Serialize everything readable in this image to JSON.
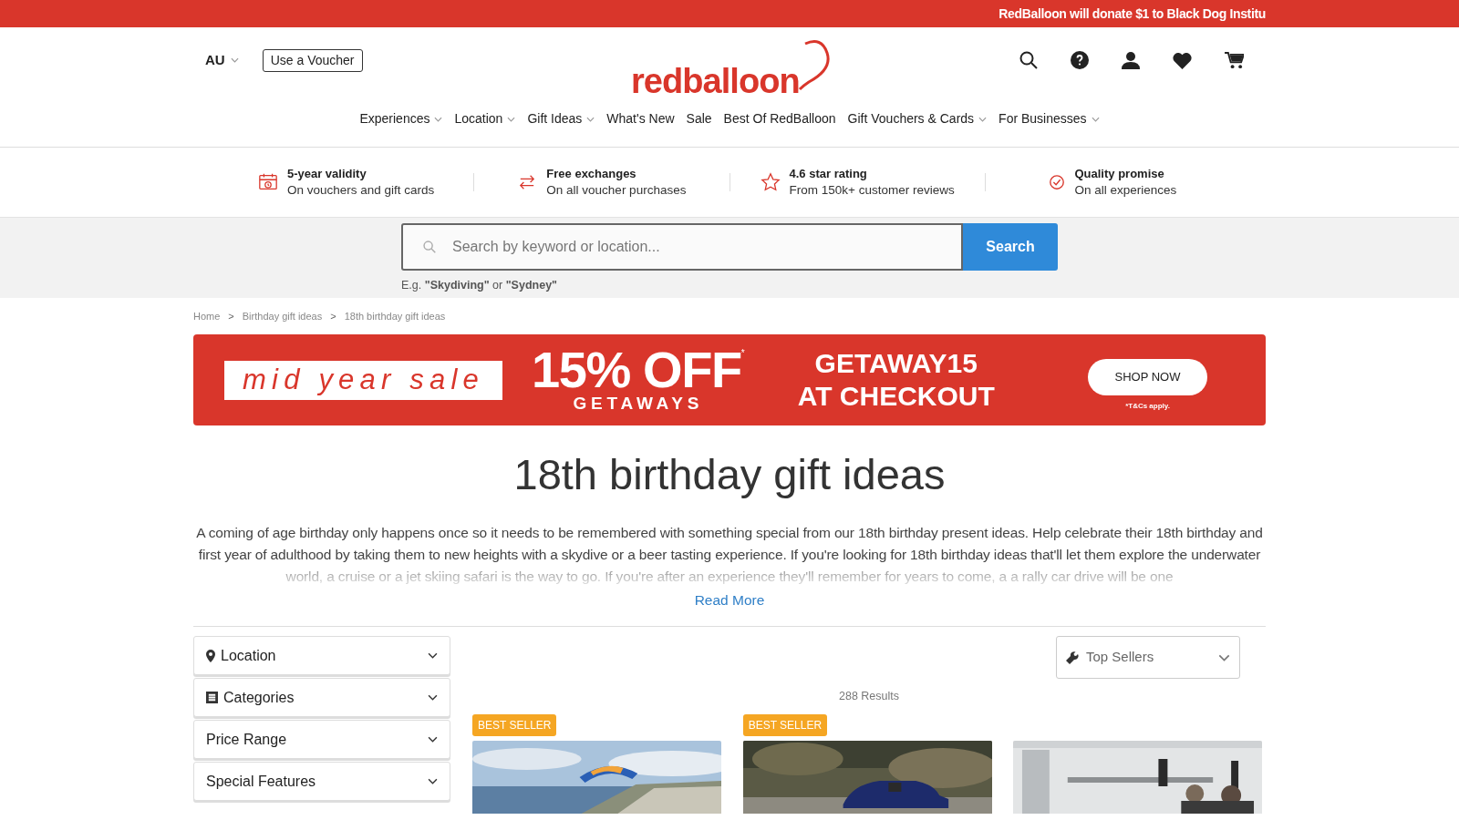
{
  "promo_bar": {
    "text": "RedBalloon will donate $1 to Black Dog Institu"
  },
  "header": {
    "region": "AU",
    "voucher_button": "Use a Voucher",
    "logo": "redballoon"
  },
  "nav": [
    {
      "label": "Experiences",
      "dropdown": true
    },
    {
      "label": "Location",
      "dropdown": true
    },
    {
      "label": "Gift Ideas",
      "dropdown": true
    },
    {
      "label": "What's New",
      "dropdown": false
    },
    {
      "label": "Sale",
      "dropdown": false
    },
    {
      "label": "Best Of RedBalloon",
      "dropdown": false
    },
    {
      "label": "Gift Vouchers & Cards",
      "dropdown": true
    },
    {
      "label": "For Businesses",
      "dropdown": true
    }
  ],
  "features": [
    {
      "kind": "calendar",
      "title": "5-year validity",
      "subtitle": "On vouchers and gift cards"
    },
    {
      "kind": "exchange",
      "title": "Free exchanges",
      "subtitle": "On all voucher purchases"
    },
    {
      "kind": "star",
      "title": "4.6 star rating",
      "subtitle": "From 150k+ customer reviews"
    },
    {
      "kind": "check",
      "title": "Quality promise",
      "subtitle": "On all experiences"
    }
  ],
  "search": {
    "placeholder": "Search by keyword or location...",
    "button": "Search",
    "hint": "E.g. **\"Skydiving\"** or **\"Sydney\"**"
  },
  "breadcrumb": [
    {
      "kind": "link",
      "text": "Home"
    },
    {
      "kind": "separator",
      "text": ">"
    },
    {
      "kind": "link",
      "text": "Birthday gift ideas"
    },
    {
      "kind": "separator",
      "text": ">"
    },
    {
      "kind": "link",
      "text": "18th birthday gift ideas"
    }
  ],
  "banner": {
    "sale": "mid year sale",
    "discount": "15% OFF",
    "mark": "*",
    "category": "GETAWAYS",
    "code": "GETAWAY15",
    "code_note": "AT CHECKOUT",
    "button": "SHOP NOW",
    "terms": "*T&Cs apply."
  },
  "title": "18th birthday gift ideas",
  "intro": "A coming of age birthday only happens once so it needs to be remembered with something special from our 18th birthday present ideas. Help celebrate their 18th birthday and first year of adulthood by taking them to new heights with a skydive or a beer tasting experience. If you're looking for 18th birthday ideas that'll let them explore the underwater world, a cruise or a jet skiing safari is the way to go. If you're after an experience they'll remember for years to come, a a rally car drive will be one",
  "read_more": "Read More",
  "filters": [
    {
      "kind": "location",
      "label": "Location"
    },
    {
      "kind": "list",
      "label": "Categories"
    },
    {
      "kind": "plain",
      "label": "Price Range"
    },
    {
      "kind": "plain",
      "label": "Special Features"
    }
  ],
  "sort": {
    "label": "Top Sellers"
  },
  "results": "288 Results",
  "products": [
    {
      "badge": "BEST SELLER",
      "kind": "picture"
    },
    {
      "badge": "BEST SELLER",
      "kind": "picture"
    },
    {
      "kind": "picture"
    }
  ]
}
